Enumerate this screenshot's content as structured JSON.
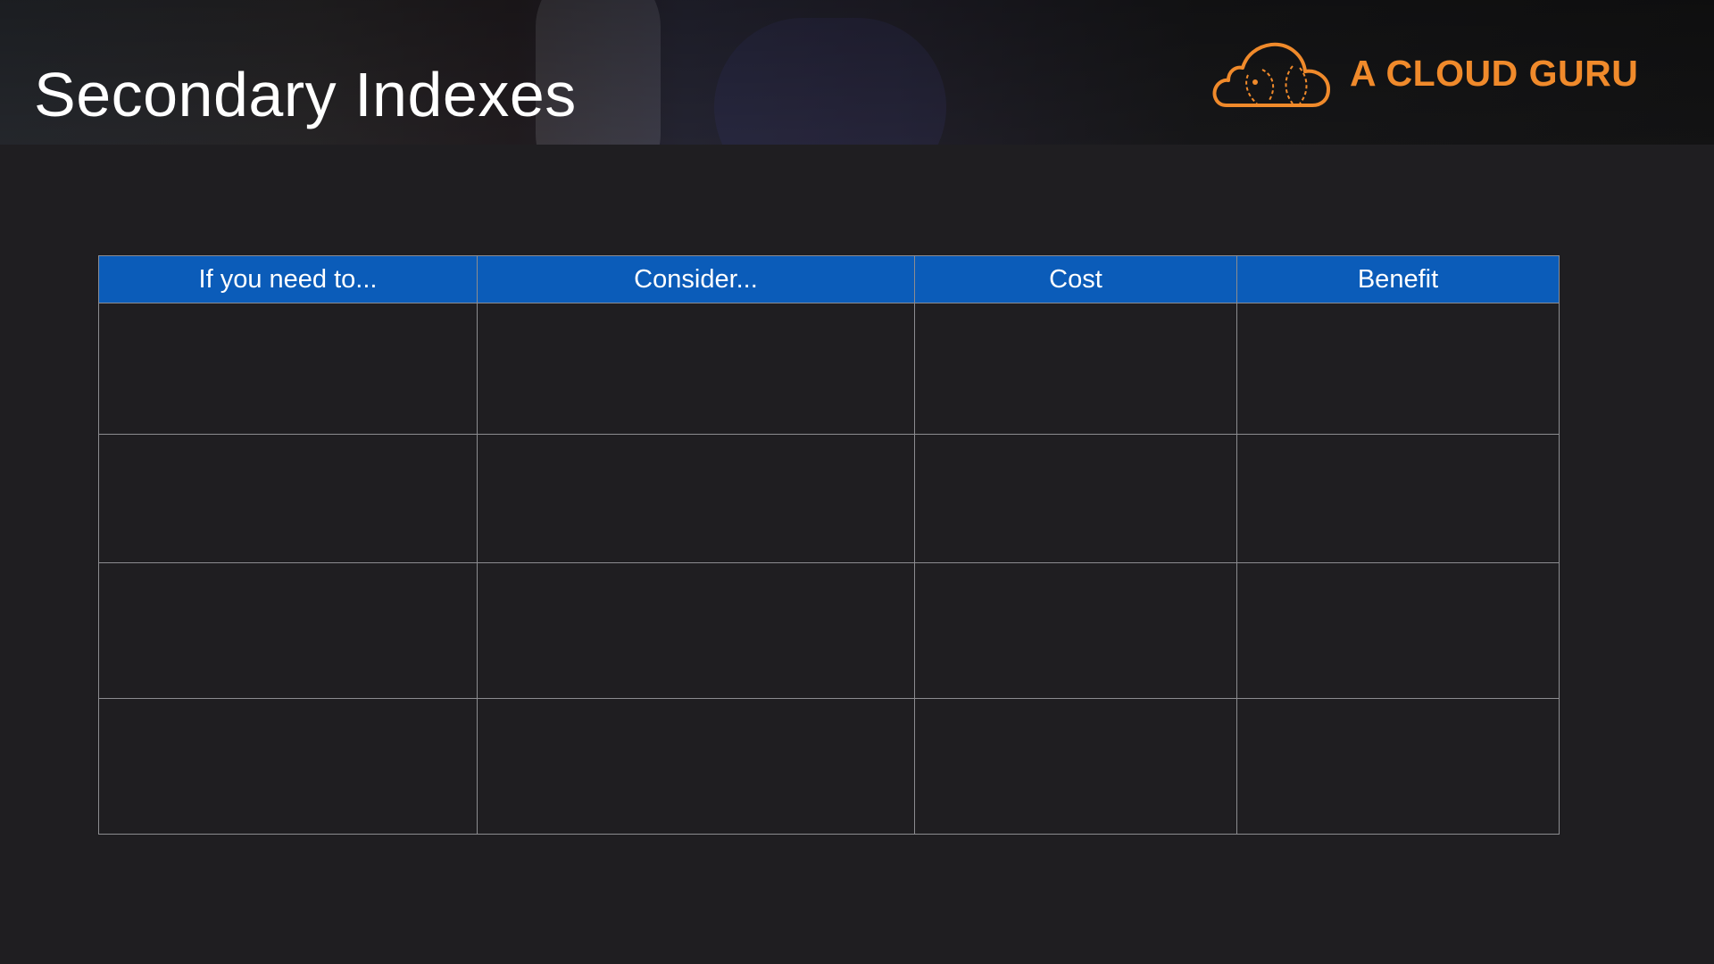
{
  "slide": {
    "title": "Secondary Indexes"
  },
  "brand": {
    "name": "A CLOUD GURU",
    "logo_icon": "cloud-icon",
    "color": "#f08a2b"
  },
  "table": {
    "header_color": "#0b5cb9",
    "columns": [
      "If you need to...",
      "Consider...",
      "Cost",
      "Benefit"
    ],
    "rows": [
      [
        "",
        "",
        "",
        ""
      ],
      [
        "",
        "",
        "",
        ""
      ],
      [
        "",
        "",
        "",
        ""
      ],
      [
        "",
        "",
        "",
        ""
      ]
    ]
  }
}
